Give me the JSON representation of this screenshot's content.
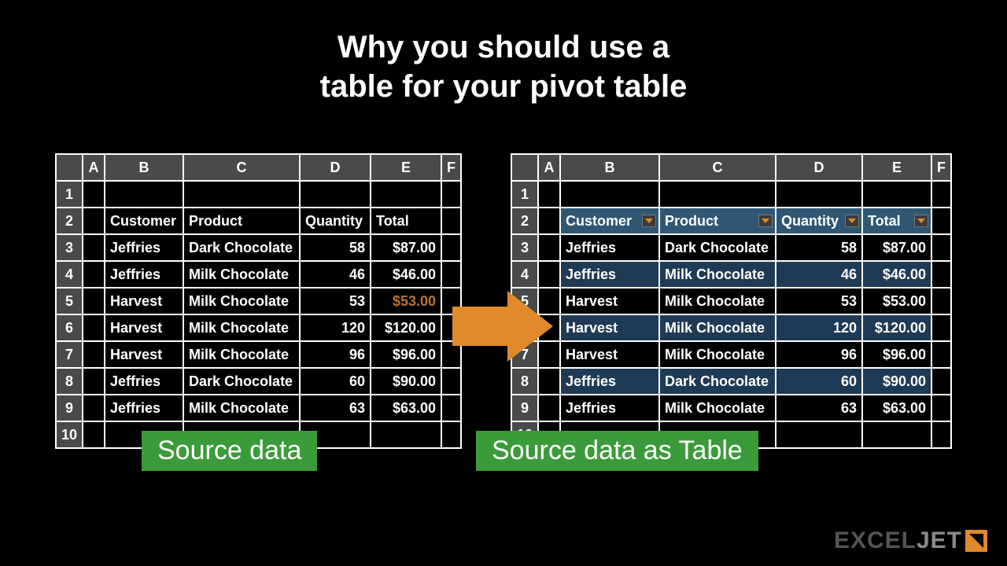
{
  "title_line1": "Why you should use a",
  "title_line2": "table for your pivot table",
  "columns": [
    "A",
    "B",
    "C",
    "D",
    "E",
    "F"
  ],
  "row_numbers": [
    "1",
    "2",
    "3",
    "4",
    "5",
    "6",
    "7",
    "8",
    "9",
    "10"
  ],
  "headers": {
    "customer": "Customer",
    "product": "Product",
    "quantity": "Quantity",
    "total": "Total"
  },
  "rows": [
    {
      "customer": "Jeffries",
      "product": "Dark Chocolate",
      "qty": "58",
      "total": "$87.00"
    },
    {
      "customer": "Jeffries",
      "product": "Milk Chocolate",
      "qty": "46",
      "total": "$46.00"
    },
    {
      "customer": "Harvest",
      "product": "Milk Chocolate",
      "qty": "53",
      "total": "$53.00"
    },
    {
      "customer": "Harvest",
      "product": "Milk Chocolate",
      "qty": "120",
      "total": "$120.00"
    },
    {
      "customer": "Harvest",
      "product": "Milk Chocolate",
      "qty": "96",
      "total": "$96.00"
    },
    {
      "customer": "Jeffries",
      "product": "Dark Chocolate",
      "qty": "60",
      "total": "$90.00"
    },
    {
      "customer": "Jeffries",
      "product": "Milk Chocolate",
      "qty": "63",
      "total": "$63.00"
    }
  ],
  "label_left": "Source data",
  "label_right": "Source data as Table",
  "logo": "EXCELJET"
}
